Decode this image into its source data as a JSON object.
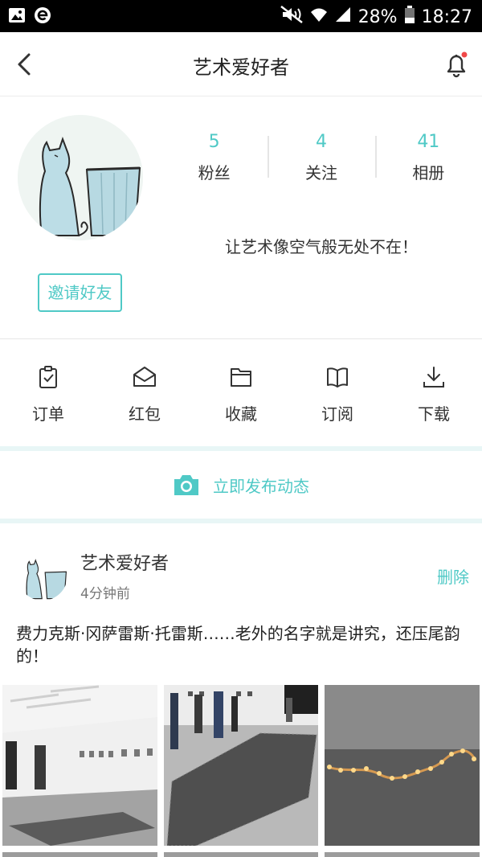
{
  "status_bar": {
    "battery": "28%",
    "time": "18:27"
  },
  "header": {
    "title": "艺术爱好者"
  },
  "profile": {
    "stats": [
      {
        "value": "5",
        "label": "粉丝"
      },
      {
        "value": "4",
        "label": "关注"
      },
      {
        "value": "41",
        "label": "相册"
      }
    ],
    "signature": "让艺术像空气般无处不在！",
    "invite_label": "邀请好友"
  },
  "menu": [
    {
      "label": "订单",
      "icon": "clipboard-check-icon"
    },
    {
      "label": "红包",
      "icon": "envelope-icon"
    },
    {
      "label": "收藏",
      "icon": "folder-icon"
    },
    {
      "label": "订阅",
      "icon": "book-icon"
    },
    {
      "label": "下载",
      "icon": "download-icon"
    }
  ],
  "compose": {
    "label": "立即发布动态",
    "icon": "camera-icon"
  },
  "post": {
    "author": "艺术爱好者",
    "time": "4分钟前",
    "delete_label": "删除",
    "text": "费力克斯·冈萨雷斯·托雷斯……老外的名字就是讲究，还压尾韵的！",
    "photos": [
      "gallery-room-photo",
      "gallery-candy-floor-photo",
      "candle-lights-photo"
    ]
  },
  "colors": {
    "accent": "#4fc9c6",
    "status_bar": "#000000",
    "band": "#e8f6f6",
    "notification_dot": "#f04848"
  }
}
